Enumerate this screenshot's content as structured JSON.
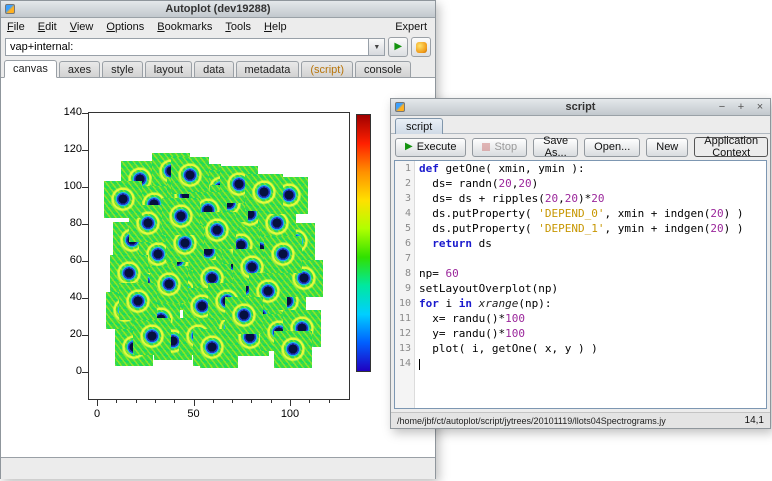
{
  "main_window": {
    "title": "Autoplot (dev19288)",
    "menu": {
      "items": [
        "File",
        "Edit",
        "View",
        "Options",
        "Bookmarks",
        "Tools",
        "Help"
      ],
      "expert": "Expert"
    },
    "address": {
      "value": "vap+internal:"
    },
    "tabs": [
      "canvas",
      "axes",
      "style",
      "layout",
      "data",
      "metadata",
      "(script)",
      "console"
    ],
    "selected_tab": "canvas"
  },
  "plot": {
    "x_ticks": [
      0,
      50,
      100
    ],
    "y_ticks": [
      0,
      20,
      40,
      60,
      80,
      100,
      120,
      140
    ],
    "colorbar_colors": [
      "#a00000",
      "#ff2000",
      "#ff9000",
      "#ffe000",
      "#b0ff00",
      "#30e000",
      "#00e8a0",
      "#00cfff",
      "#0060ff",
      "#2000c0"
    ],
    "patch_size": 20,
    "patches": [
      [
        12,
        95
      ],
      [
        28,
        99
      ],
      [
        44,
        93
      ],
      [
        19,
        81
      ],
      [
        36,
        86
      ],
      [
        54,
        90
      ],
      [
        8,
        62
      ],
      [
        24,
        66
      ],
      [
        41,
        71
      ],
      [
        56,
        64
      ],
      [
        69,
        76
      ],
      [
        31,
        51
      ],
      [
        47,
        56
      ],
      [
        61,
        49
      ],
      [
        74,
        57
      ],
      [
        14,
        39
      ],
      [
        34,
        34
      ],
      [
        49,
        41
      ],
      [
        66,
        36
      ],
      [
        79,
        46
      ],
      [
        4,
        24
      ],
      [
        23,
        19
      ],
      [
        44,
        26
      ],
      [
        59,
        14
      ],
      [
        74,
        21
      ],
      [
        88,
        29
      ],
      [
        9,
        4
      ],
      [
        29,
        7
      ],
      [
        53,
        3
      ],
      [
        69,
        9
      ],
      [
        84,
        12
      ],
      [
        93,
        61
      ],
      [
        83,
        71
      ],
      [
        89,
        86
      ],
      [
        97,
        41
      ],
      [
        96,
        14
      ],
      [
        38,
        97
      ],
      [
        58,
        82
      ],
      [
        47,
        78
      ],
      [
        21,
        54
      ],
      [
        64,
        59
      ],
      [
        6,
        44
      ],
      [
        52,
        67
      ],
      [
        16,
        71
      ],
      [
        70,
        47
      ],
      [
        35,
        60
      ],
      [
        27,
        38
      ],
      [
        57,
        29
      ],
      [
        42,
        10
      ],
      [
        18,
        10
      ],
      [
        63,
        92
      ],
      [
        76,
        88
      ],
      [
        11,
        29
      ],
      [
        86,
        54
      ],
      [
        91,
        3
      ],
      [
        3,
        84
      ],
      [
        49,
        4
      ],
      [
        78,
        34
      ],
      [
        33,
        75
      ],
      [
        66,
        21
      ]
    ]
  },
  "script_window": {
    "title": "script",
    "window_icons": {
      "minimize": "−",
      "maximize": "+",
      "close": "×"
    },
    "tab": "script",
    "toolbar": {
      "execute": "Execute",
      "stop": "Stop",
      "save_as": "Save As...",
      "open": "Open...",
      "new": "New",
      "context": "Application Context"
    },
    "editor": {
      "caret_line": 14,
      "lines": [
        [
          {
            "c": "kw",
            "t": "def"
          },
          {
            "c": "",
            "t": " getOne( xmin, ymin ):"
          }
        ],
        [
          {
            "c": "",
            "t": "  ds= randn("
          },
          {
            "c": "num",
            "t": "20"
          },
          {
            "c": "",
            "t": ","
          },
          {
            "c": "num",
            "t": "20"
          },
          {
            "c": "",
            "t": ")"
          }
        ],
        [
          {
            "c": "",
            "t": "  ds= ds + ripples("
          },
          {
            "c": "num",
            "t": "20"
          },
          {
            "c": "",
            "t": ","
          },
          {
            "c": "num",
            "t": "20"
          },
          {
            "c": "",
            "t": ")*"
          },
          {
            "c": "num",
            "t": "20"
          }
        ],
        [
          {
            "c": "",
            "t": "  ds.putProperty( "
          },
          {
            "c": "str",
            "t": "'DEPEND_0'"
          },
          {
            "c": "",
            "t": ", xmin + indgen("
          },
          {
            "c": "num",
            "t": "20"
          },
          {
            "c": "",
            "t": ") )"
          }
        ],
        [
          {
            "c": "",
            "t": "  ds.putProperty( "
          },
          {
            "c": "str",
            "t": "'DEPEND_1'"
          },
          {
            "c": "",
            "t": ", ymin + indgen("
          },
          {
            "c": "num",
            "t": "20"
          },
          {
            "c": "",
            "t": ") )"
          }
        ],
        [
          {
            "c": "",
            "t": "  "
          },
          {
            "c": "kw",
            "t": "return"
          },
          {
            "c": "",
            "t": " ds"
          }
        ],
        [],
        [
          {
            "c": "",
            "t": "np= "
          },
          {
            "c": "num",
            "t": "60"
          }
        ],
        [
          {
            "c": "",
            "t": "setLayoutOverplot(np)"
          }
        ],
        [
          {
            "c": "kw",
            "t": "for"
          },
          {
            "c": "",
            "t": " i "
          },
          {
            "c": "kw",
            "t": "in"
          },
          {
            "c": "",
            "t": " "
          },
          {
            "c": "bi",
            "t": "xrange"
          },
          {
            "c": "",
            "t": "(np):"
          }
        ],
        [
          {
            "c": "",
            "t": "  x= randu()*"
          },
          {
            "c": "num",
            "t": "100"
          }
        ],
        [
          {
            "c": "",
            "t": "  y= randu()*"
          },
          {
            "c": "num",
            "t": "100"
          }
        ],
        [
          {
            "c": "",
            "t": "  plot( i, getOne( x, y ) )"
          }
        ],
        []
      ]
    },
    "status": {
      "path": "/home/jbf/ct/autoplot/script/jytrees/20101119/llots04Spectrograms.jy",
      "caret": "14,1"
    }
  }
}
